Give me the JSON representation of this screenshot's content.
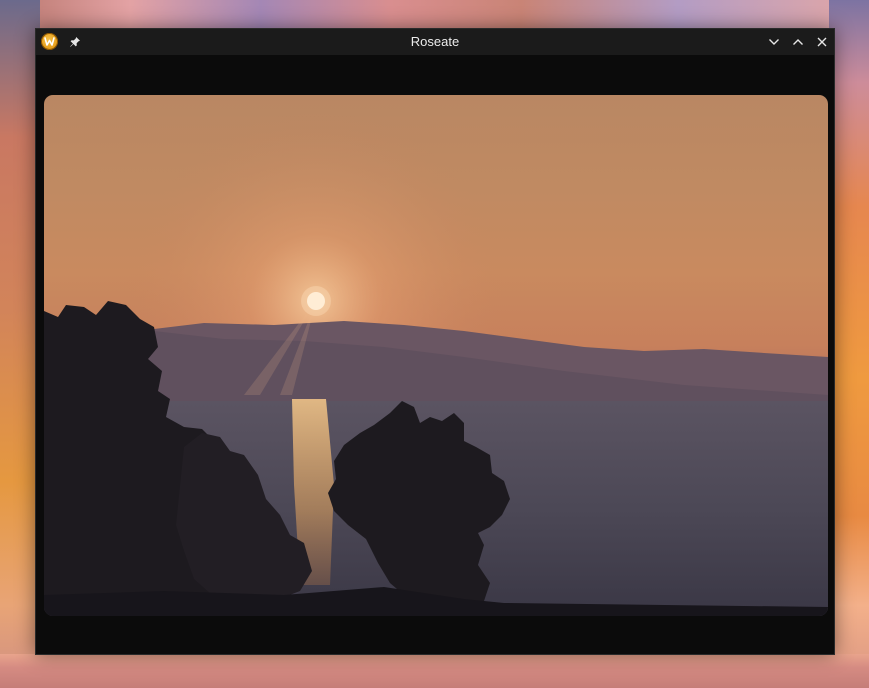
{
  "window": {
    "title": "Roseate"
  },
  "icons": {
    "app": "app-logo-icon",
    "pin": "pin-icon",
    "minimize": "chevron-down-icon",
    "maximize": "chevron-up-icon",
    "close": "close-icon"
  },
  "colors": {
    "titlebar": "#1b1b1b",
    "window_background": "#0b0b0b",
    "app_icon_accent": "#e39a16",
    "sun": "#fff3e0"
  }
}
